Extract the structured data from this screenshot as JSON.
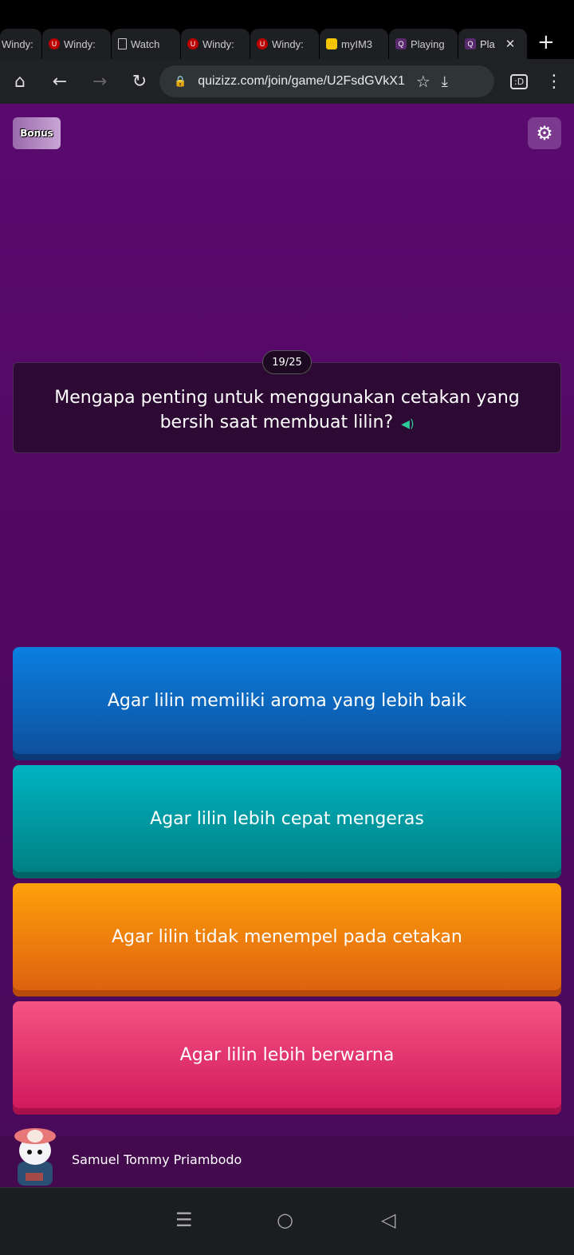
{
  "browser": {
    "tabs": [
      {
        "title": "Windy: ",
        "icon": "none"
      },
      {
        "title": "Windy: ",
        "icon": "windy-icon"
      },
      {
        "title": "Watch ",
        "icon": "document-icon"
      },
      {
        "title": "Windy: ",
        "icon": "windy-icon"
      },
      {
        "title": "Windy: ",
        "icon": "windy-icon"
      },
      {
        "title": "myIM3",
        "icon": "myim3-icon"
      },
      {
        "title": "Playing",
        "icon": "quizizz-icon"
      },
      {
        "title": "Pla",
        "icon": "quizizz-icon",
        "active": true
      }
    ],
    "url": "quizizz.com/join/game/U2FsdGVkX1",
    "close_glyph": "✕",
    "new_tab_glyph": "+"
  },
  "game": {
    "bonus_label": "Bonus",
    "counter": "19/25",
    "question": "Mengapa penting untuk menggunakan cetakan yang bersih saat membuat lilin?",
    "options": [
      {
        "text": "Agar lilin memiliki aroma yang lebih baik",
        "color": "#0a7fe0"
      },
      {
        "text": "Agar lilin lebih cepat mengeras",
        "color": "#00b3c2"
      },
      {
        "text": "Agar lilin tidak menempel pada cetakan",
        "color": "#ffa00a"
      },
      {
        "text": "Agar lilin lebih berwarna",
        "color": "#f45382"
      }
    ],
    "player_name": "Samuel Tommy Priambodo"
  }
}
